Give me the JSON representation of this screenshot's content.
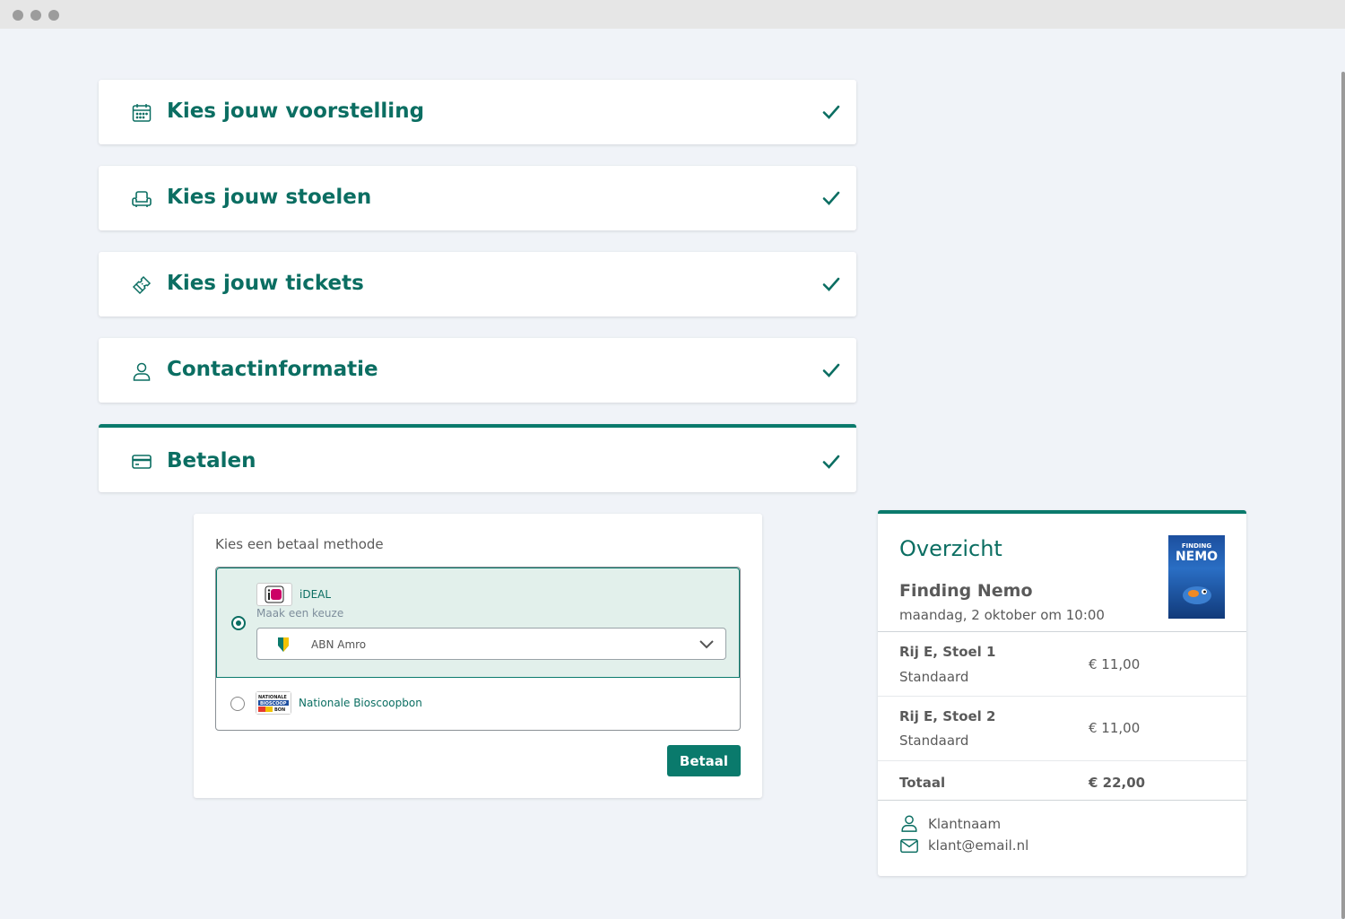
{
  "window": {
    "controls": [
      "close-dot",
      "minimize-dot",
      "maximize-dot"
    ]
  },
  "steps": [
    {
      "title": "Kies jouw voorstelling",
      "icon": "calendar-icon",
      "completed": true
    },
    {
      "title": "Kies jouw stoelen",
      "icon": "seat-icon",
      "completed": true
    },
    {
      "title": "Kies jouw tickets",
      "icon": "ticket-icon",
      "completed": true
    },
    {
      "title": "Contactinformatie",
      "icon": "user-icon",
      "completed": true
    },
    {
      "title": "Betalen",
      "icon": "credit-card-icon",
      "completed": true,
      "active": true
    }
  ],
  "payment": {
    "heading": "Kies een betaal methode",
    "methods": [
      {
        "name": "iDEAL",
        "selected": true,
        "logo": "ideal-logo",
        "sub_label": "Maak een keuze",
        "bank_select": {
          "value": "ABN Amro",
          "icon": "abn-amro-logo"
        }
      },
      {
        "name": "Nationale Bioscoopbon",
        "selected": false,
        "logo": "nationale-bioscoopbon-logo",
        "logo_text": [
          "NATIONALE",
          "BIOSCOOP",
          "BON"
        ]
      }
    ],
    "pay_button": "Betaal"
  },
  "overview": {
    "title": "Overzicht",
    "movie": "Finding Nemo",
    "datetime": "maandag, 2 oktober om 10:00",
    "poster_text": [
      "FINDING",
      "NEMO"
    ],
    "seats": [
      {
        "seat": "Rij E, Stoel 1",
        "type": "Standaard",
        "price": "€ 11,00"
      },
      {
        "seat": "Rij E, Stoel 2",
        "type": "Standaard",
        "price": "€ 11,00"
      }
    ],
    "total_label": "Totaal",
    "total_price": "€ 22,00",
    "customer_name": "Klantnaam",
    "customer_email": "klant@email.nl"
  },
  "colors": {
    "accent": "#0a7a6c",
    "background": "#f0f3f8",
    "selected_bg": "#e2f0eb"
  }
}
